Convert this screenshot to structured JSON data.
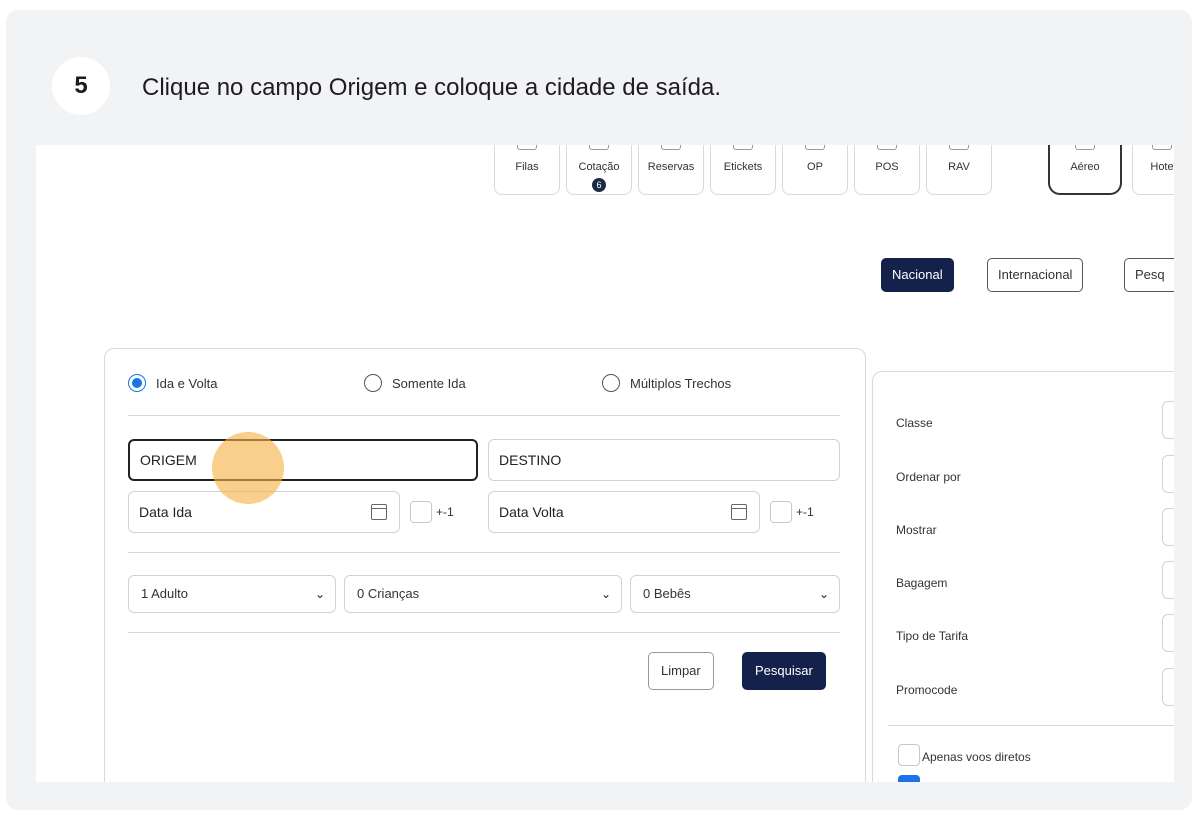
{
  "step": {
    "number": "5",
    "instruction": "Clique no campo Origem e coloque a cidade de saída."
  },
  "toolbar": {
    "items": [
      {
        "label": "Filas",
        "icon": "queue-icon"
      },
      {
        "label": "Cotação",
        "icon": "quote-icon",
        "badge": "6"
      },
      {
        "label": "Reservas",
        "icon": "reservations-icon"
      },
      {
        "label": "Etickets",
        "icon": "ticket-icon"
      },
      {
        "label": "OP",
        "icon": "op-icon"
      },
      {
        "label": "POS",
        "icon": "pos-icon"
      },
      {
        "label": "RAV",
        "icon": "rav-icon"
      },
      {
        "label": "Aéreo",
        "icon": "plane-icon"
      },
      {
        "label": "Hote",
        "icon": "hotel-icon"
      }
    ]
  },
  "scope": {
    "nacional": "Nacional",
    "internacional": "Internacional",
    "pesq": "Pesq"
  },
  "trip_type": {
    "ida_volta": "Ida e Volta",
    "somente_ida": "Somente Ida",
    "multiplos": "Múltiplos Trechos",
    "selected": "ida_volta"
  },
  "fields": {
    "origem_value": "ORIGEM",
    "destino_placeholder": "DESTINO",
    "data_ida_placeholder": "Data Ida",
    "data_volta_placeholder": "Data Volta",
    "flex_label": "+-1"
  },
  "passengers": {
    "adults": "1 Adulto",
    "children": "0 Crianças",
    "babies": "0 Bebês"
  },
  "actions": {
    "limpar": "Limpar",
    "pesquisar": "Pesquisar"
  },
  "filters": {
    "classe": "Classe",
    "ordenar": "Ordenar por",
    "mostrar": "Mostrar",
    "bagagem": "Bagagem",
    "tipo_tarifa": "Tipo de Tarifa",
    "promocode": "Promocode",
    "apenas_diretos": "Apenas voos diretos"
  },
  "colors": {
    "accent_dark": "#14214a",
    "radio_blue": "#1a73e8",
    "click_marker": "#f7b043"
  }
}
